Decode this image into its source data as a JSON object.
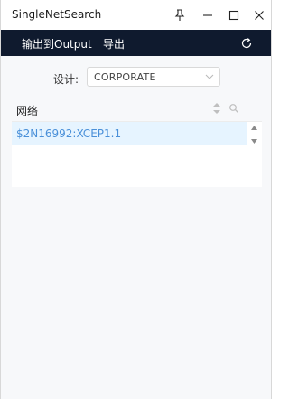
{
  "window": {
    "title": "SingleNetSearch"
  },
  "menu": {
    "output_label": "输出到Output",
    "export_label": "导出"
  },
  "design": {
    "label": "设计:",
    "value": "CORPORATE"
  },
  "table": {
    "column": "网络",
    "rows": [
      {
        "net": "$2N16992:XCEP1.1"
      }
    ]
  },
  "colors": {
    "menubar_bg": "#0f1a2e",
    "row_selected_bg": "#e6f4ff",
    "row_text": "#4a90d9"
  },
  "icons": [
    "pin-icon",
    "minimize-icon",
    "maximize-icon",
    "close-icon",
    "refresh-icon",
    "chevron-down-icon",
    "sort-icon",
    "search-icon",
    "scroll-up-icon",
    "scroll-down-icon"
  ]
}
